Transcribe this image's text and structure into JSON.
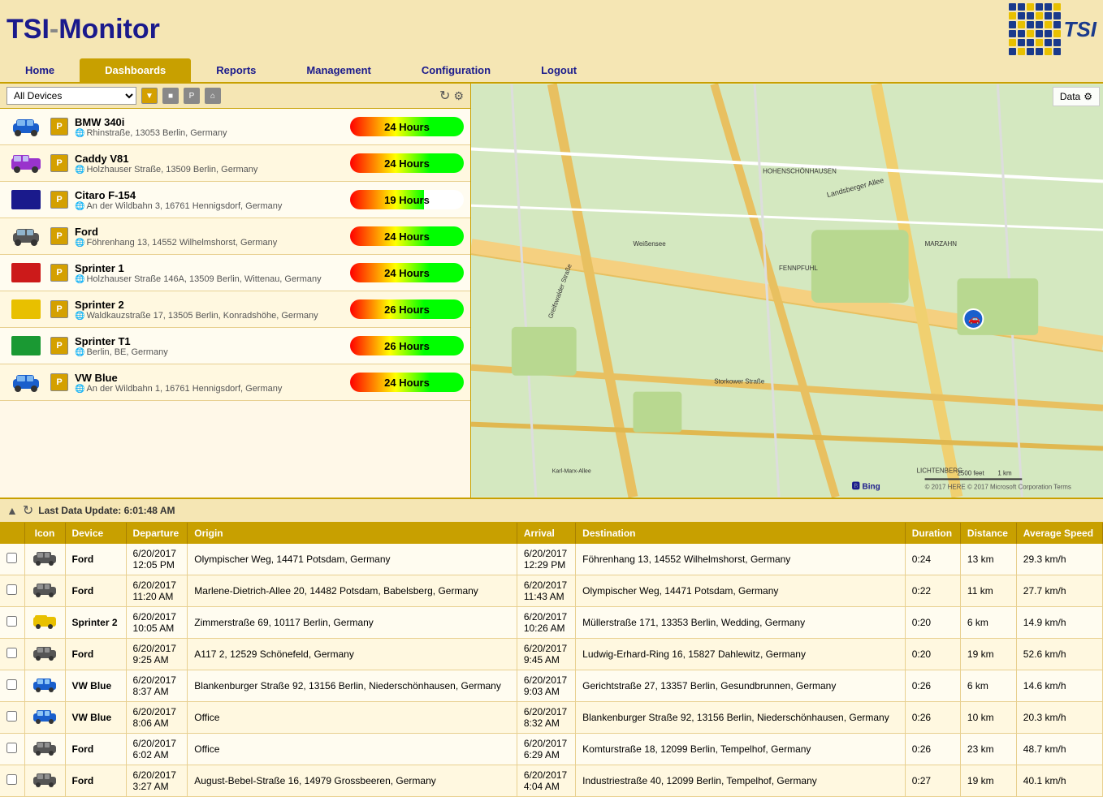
{
  "header": {
    "title_tsi": "TSI",
    "title_monitor": "-Monitor",
    "logo_alt": "TSI Logo"
  },
  "nav": {
    "items": [
      {
        "label": "Home",
        "active": false
      },
      {
        "label": "Dashboards",
        "active": true
      },
      {
        "label": "Reports",
        "active": false
      },
      {
        "label": "Management",
        "active": false
      },
      {
        "label": "Configuration",
        "active": false
      },
      {
        "label": "Logout",
        "active": false
      }
    ]
  },
  "left_panel": {
    "device_select": "All Devices",
    "refresh_icon": "↻",
    "settings_icon": "⚙"
  },
  "vehicles": [
    {
      "name": "BMW 340i",
      "address": "Rhinstraße, 13053 Berlin, Germany",
      "hours": "24 Hours",
      "bar_type": "full",
      "icon_color": "#1a5fcc",
      "icon_type": "car"
    },
    {
      "name": "Caddy V81",
      "address": "Holzhauser Straße, 13509 Berlin, Germany",
      "hours": "24 Hours",
      "bar_type": "full",
      "icon_color": "#9933cc",
      "icon_type": "van"
    },
    {
      "name": "Citaro F-154",
      "address": "An der Wildbahn 3, 16761 Hennigsdorf, Germany",
      "hours": "19 Hours",
      "bar_type": "19",
      "icon_color": "#1a1a8c",
      "icon_type": "block"
    },
    {
      "name": "Ford",
      "address": "Föhrenhang 13, 14552 Wilhelmshorst, Germany",
      "hours": "24 Hours",
      "bar_type": "full",
      "icon_color": "#555",
      "icon_type": "car"
    },
    {
      "name": "Sprinter 1",
      "address": "Holzhauser Straße 146A, 13509 Berlin, Wittenau, Germany",
      "hours": "24 Hours",
      "bar_type": "full",
      "icon_color": "#cc1a1a",
      "icon_type": "block"
    },
    {
      "name": "Sprinter 2",
      "address": "Waldkauzstraße 17, 13505 Berlin, Konradshöhe, Germany",
      "hours": "26 Hours",
      "bar_type": "26",
      "icon_color": "#e8c000",
      "icon_type": "block"
    },
    {
      "name": "Sprinter T1",
      "address": "Berlin, BE, Germany",
      "hours": "26 Hours",
      "bar_type": "26",
      "icon_color": "#1a9933",
      "icon_type": "block"
    },
    {
      "name": "VW Blue",
      "address": "An der Wildbahn 1, 16761 Hennigsdorf, Germany",
      "hours": "24 Hours",
      "bar_type": "full",
      "icon_color": "#1a5fcc",
      "icon_type": "car"
    }
  ],
  "map": {
    "data_label": "Data",
    "settings_icon": "⚙"
  },
  "bottom": {
    "last_update": "Last Data Update: 6:01:48 AM",
    "refresh_icon": "↻",
    "nav_up": "▲",
    "nav_down": "▼"
  },
  "table": {
    "headers": [
      "Icon",
      "Device",
      "Departure",
      "Origin",
      "Arrival",
      "Destination",
      "Duration",
      "Distance",
      "Average Speed"
    ],
    "rows": [
      {
        "device": "Ford",
        "icon_color": "#555",
        "departure": "6/20/2017\n12:05 PM",
        "origin": "Olympischer Weg,  14471 Potsdam,  Germany",
        "arrival": "6/20/2017\n12:29 PM",
        "destination": "Föhrenhang 13,  14552 Wilhelmshorst,  Germany",
        "duration": "0:24",
        "distance": "13 km",
        "speed": "29.3 km/h"
      },
      {
        "device": "Ford",
        "icon_color": "#555",
        "departure": "6/20/2017\n11:20 AM",
        "origin": "Marlene-Dietrich-Allee 20,  14482 Potsdam,  Babelsberg, Germany",
        "arrival": "6/20/2017\n11:43 AM",
        "destination": "Olympischer Weg,  14471 Potsdam,  Germany",
        "duration": "0:22",
        "distance": "11 km",
        "speed": "27.7 km/h"
      },
      {
        "device": "Sprinter 2",
        "icon_color": "#e8c000",
        "departure": "6/20/2017\n10:05 AM",
        "origin": "Zimmerstraße 69,  10117 Berlin,  Germany",
        "arrival": "6/20/2017\n10:26 AM",
        "destination": "Müllerstraße 171,  13353 Berlin,  Wedding,  Germany",
        "duration": "0:20",
        "distance": "6 km",
        "speed": "14.9 km/h"
      },
      {
        "device": "Ford",
        "icon_color": "#555",
        "departure": "6/20/2017\n9:25 AM",
        "origin": "A117 2,  12529 Schönefeld,  Germany",
        "arrival": "6/20/2017\n9:45 AM",
        "destination": "Ludwig-Erhard-Ring 16,  15827 Dahlewitz,  Germany",
        "duration": "0:20",
        "distance": "19 km",
        "speed": "52.6 km/h"
      },
      {
        "device": "VW Blue",
        "icon_color": "#1a5fcc",
        "departure": "6/20/2017\n8:37 AM",
        "origin": "Blankenburger Straße 92,  13156 Berlin,  Niederschönhausen,  Germany",
        "arrival": "6/20/2017\n9:03 AM",
        "destination": "Gerichtstraße 27,  13357 Berlin,  Gesundbrunnen,  Germany",
        "duration": "0:26",
        "distance": "6 km",
        "speed": "14.6 km/h"
      },
      {
        "device": "VW Blue",
        "icon_color": "#1a5fcc",
        "departure": "6/20/2017\n8:06 AM",
        "origin": "Office",
        "arrival": "6/20/2017\n8:32 AM",
        "destination": "Blankenburger Straße 92,  13156 Berlin,  Niederschönhausen,  Germany",
        "duration": "0:26",
        "distance": "10 km",
        "speed": "20.3 km/h"
      },
      {
        "device": "Ford",
        "icon_color": "#555",
        "departure": "6/20/2017\n6:02 AM",
        "origin": "Office",
        "arrival": "6/20/2017\n6:29 AM",
        "destination": "Komturstraße 18,  12099 Berlin,  Tempelhof,  Germany",
        "duration": "0:26",
        "distance": "23 km",
        "speed": "48.7 km/h"
      },
      {
        "device": "Ford",
        "icon_color": "#555",
        "departure": "6/20/2017\n3:27 AM",
        "origin": "August-Bebel-Straße 16,  14979 Grossbeeren,  Germany",
        "arrival": "6/20/2017\n4:04 AM",
        "destination": "Industriestraße 40,  12099 Berlin,  Tempelhof,  Germany",
        "duration": "0:27",
        "distance": "19 km",
        "speed": "40.1 km/h"
      }
    ]
  }
}
